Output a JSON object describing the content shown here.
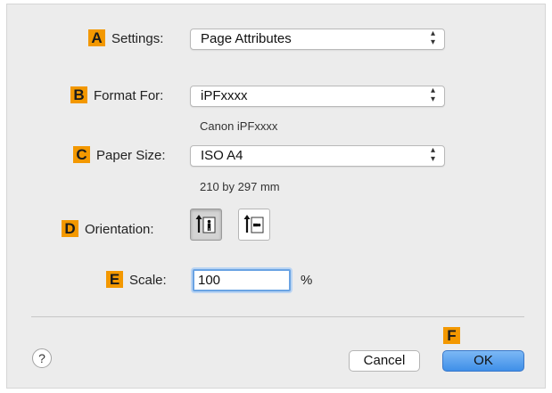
{
  "settings": {
    "badge": "A",
    "label": "Settings:",
    "value": "Page Attributes"
  },
  "format_for": {
    "badge": "B",
    "label": "Format For:",
    "value": "iPFxxxx",
    "sub": "Canon iPFxxxx"
  },
  "paper_size": {
    "badge": "C",
    "label": "Paper Size:",
    "value": "ISO A4",
    "sub": "210 by 297 mm"
  },
  "orientation": {
    "badge": "D",
    "label": "Orientation:",
    "selected": "portrait"
  },
  "scale": {
    "badge": "E",
    "label": "Scale:",
    "value": "100",
    "unit": "%"
  },
  "footer": {
    "help": "?",
    "cancel": "Cancel",
    "ok_badge": "F",
    "ok": "OK"
  },
  "colors": {
    "badge": "#f39800",
    "default_button": "#4a97ea",
    "focus_ring": "#6aa3e3"
  }
}
